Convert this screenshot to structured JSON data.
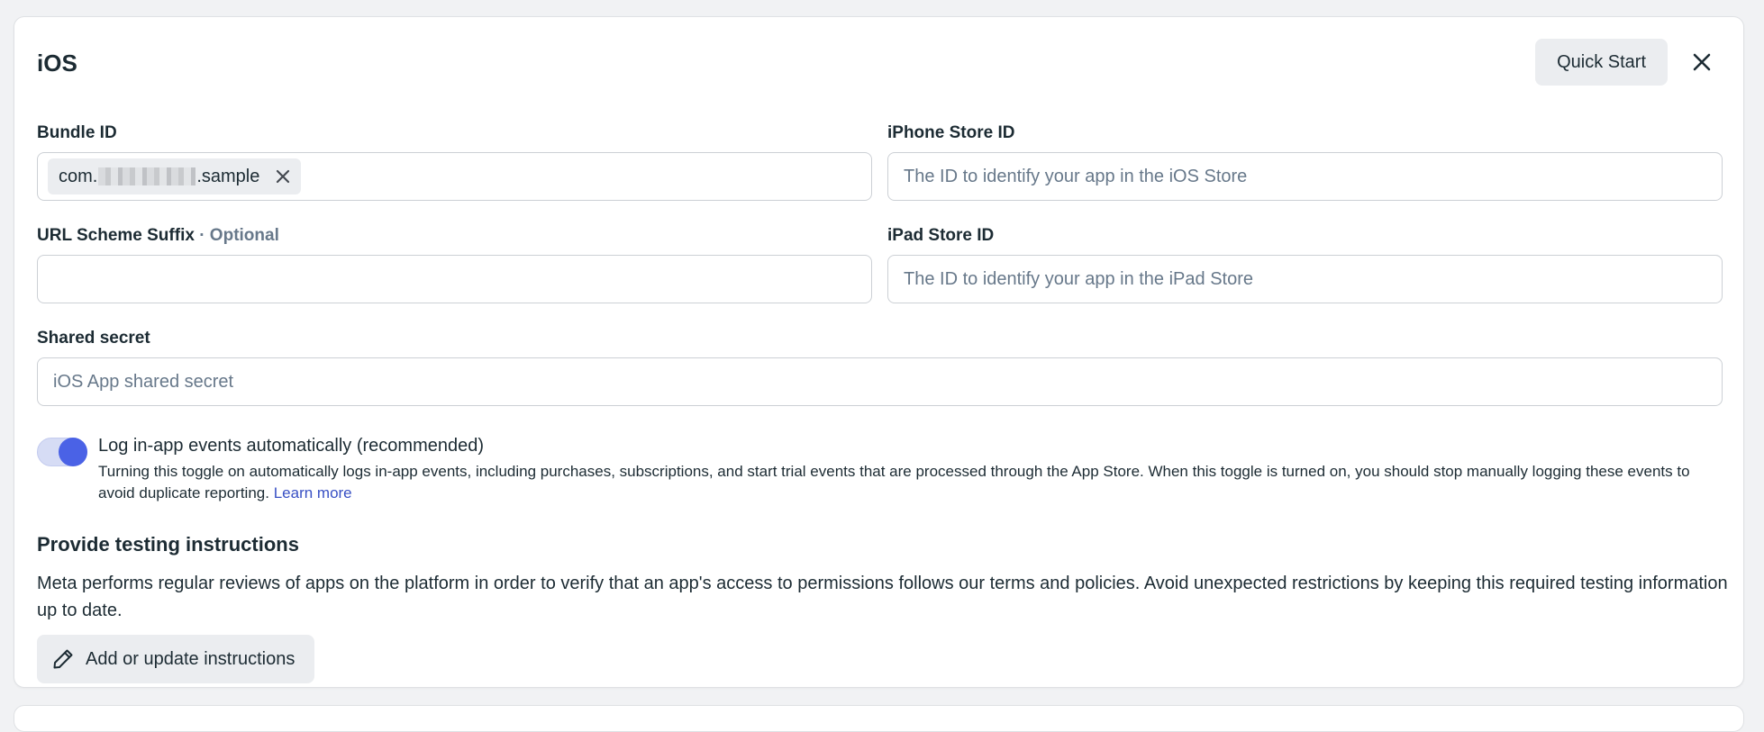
{
  "panel": {
    "title": "iOS",
    "quick_start_label": "Quick Start"
  },
  "bundle_id": {
    "label": "Bundle ID",
    "chip_prefix": "com.",
    "chip_suffix": ".sample"
  },
  "iphone_store_id": {
    "label": "iPhone Store ID",
    "placeholder": "The ID to identify your app in the iOS Store",
    "value": ""
  },
  "url_scheme_suffix": {
    "label": "URL Scheme Suffix",
    "optional": "· Optional",
    "value": ""
  },
  "ipad_store_id": {
    "label": "iPad Store ID",
    "placeholder": "The ID to identify your app in the iPad Store",
    "value": ""
  },
  "shared_secret": {
    "label": "Shared secret",
    "placeholder": "iOS App shared secret",
    "value": ""
  },
  "log_events": {
    "enabled": true,
    "title": "Log in-app events automatically (recommended)",
    "description": "Turning this toggle on automatically logs in-app events, including purchases, subscriptions, and start trial events that are processed through the App Store. When this toggle is turned on, you should stop manually logging these events to avoid duplicate reporting.",
    "learn_more": "Learn more"
  },
  "testing": {
    "title": "Provide testing instructions",
    "description": "Meta performs regular reviews of apps on the platform in order to verify that an app's access to permissions follows our terms and policies. Avoid unexpected restrictions by keeping this required testing information up to date.",
    "button_label": "Add or update instructions"
  },
  "icons": {
    "close": "close-icon",
    "chip_remove": "close-icon",
    "edit": "pencil-icon"
  },
  "colors": {
    "accent": "#4a62e6",
    "link": "#3850c4",
    "text": "#1c2b33",
    "muted": "#67788a"
  }
}
